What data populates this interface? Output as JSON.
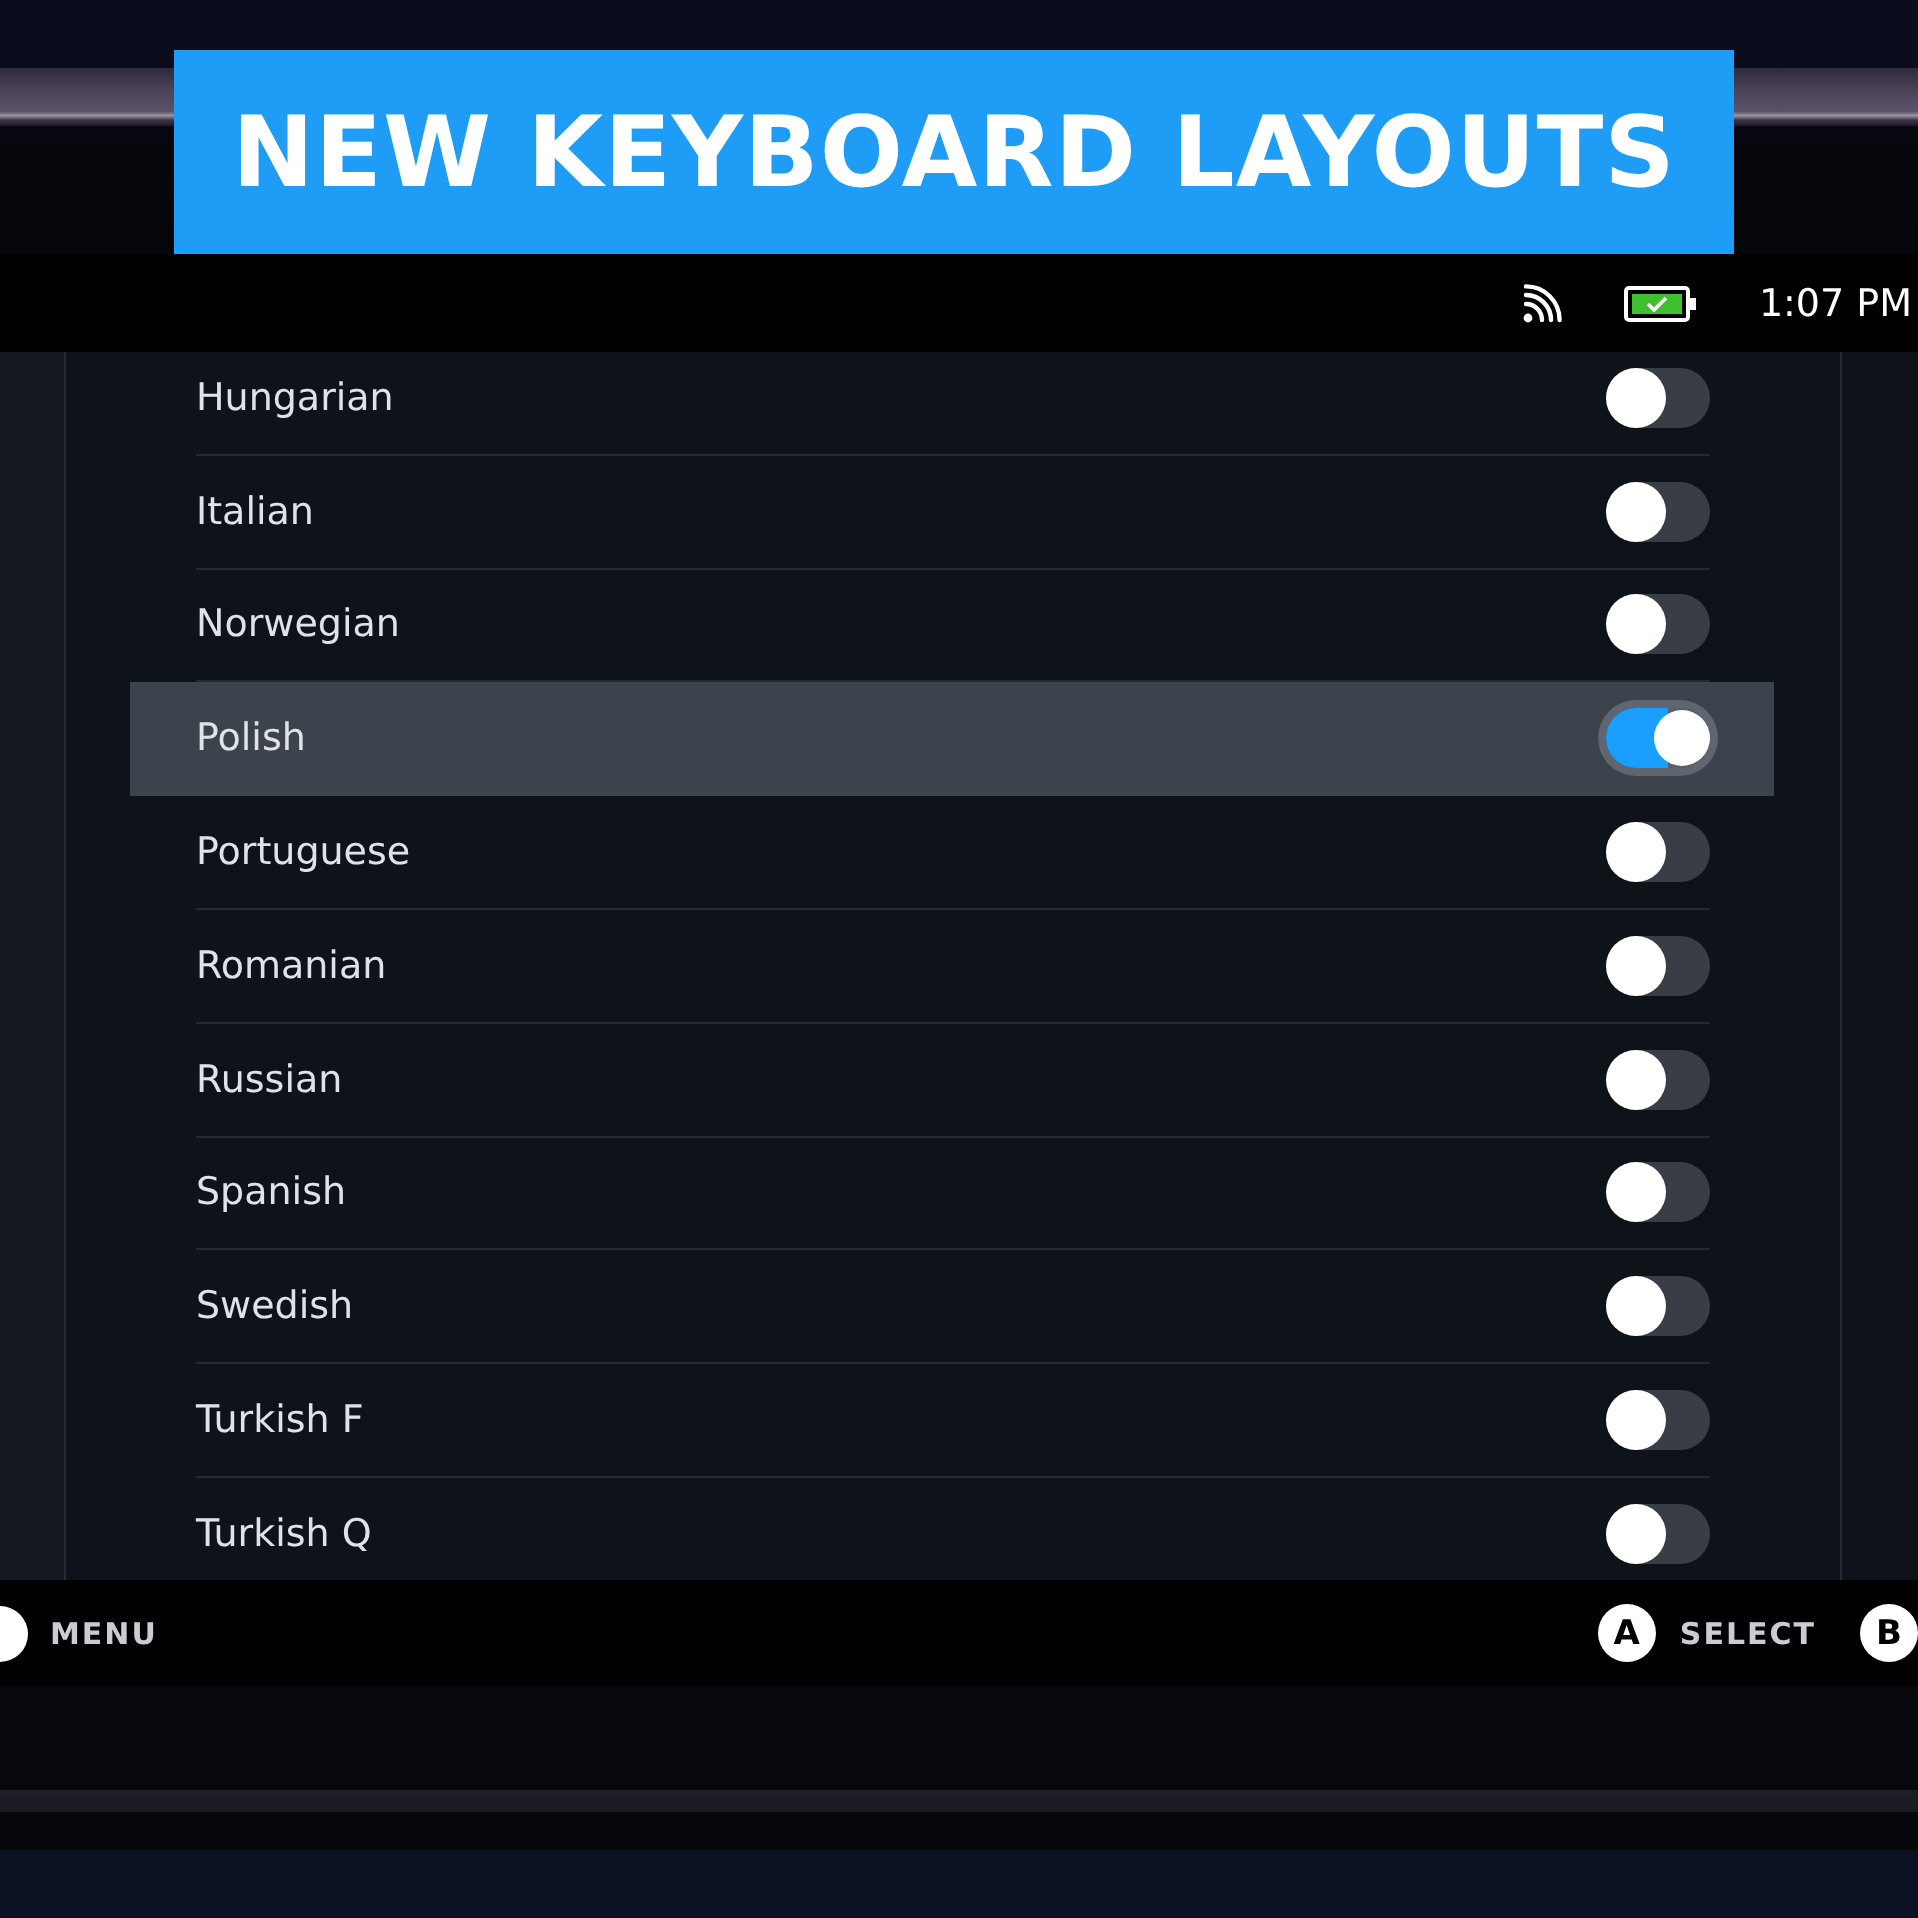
{
  "banner": {
    "title": "NEW KEYBOARD LAYOUTS"
  },
  "status_bar": {
    "time": "1:07 PM"
  },
  "layouts": [
    {
      "name": "Hungarian",
      "on": false,
      "selected": false
    },
    {
      "name": "Italian",
      "on": false,
      "selected": false
    },
    {
      "name": "Norwegian",
      "on": false,
      "selected": false
    },
    {
      "name": "Polish",
      "on": true,
      "selected": true
    },
    {
      "name": "Portuguese",
      "on": false,
      "selected": false
    },
    {
      "name": "Romanian",
      "on": false,
      "selected": false
    },
    {
      "name": "Russian",
      "on": false,
      "selected": false
    },
    {
      "name": "Spanish",
      "on": false,
      "selected": false
    },
    {
      "name": "Swedish",
      "on": false,
      "selected": false
    },
    {
      "name": "Turkish F",
      "on": false,
      "selected": false
    },
    {
      "name": "Turkish Q",
      "on": false,
      "selected": false
    }
  ],
  "footer": {
    "menu": {
      "label": "MENU"
    },
    "actions": [
      {
        "button": "A",
        "label": "SELECT"
      },
      {
        "button": "B"
      }
    ]
  }
}
